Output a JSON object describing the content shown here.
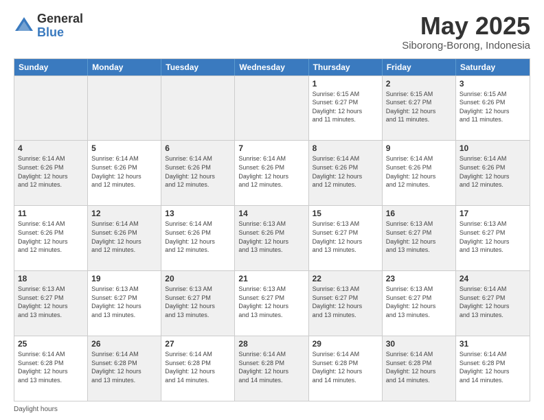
{
  "logo": {
    "general": "General",
    "blue": "Blue"
  },
  "title": "May 2025",
  "location": "Siborong-Borong, Indonesia",
  "header_days": [
    "Sunday",
    "Monday",
    "Tuesday",
    "Wednesday",
    "Thursday",
    "Friday",
    "Saturday"
  ],
  "footer": "Daylight hours",
  "weeks": [
    [
      {
        "day": "",
        "info": "",
        "shaded": true
      },
      {
        "day": "",
        "info": "",
        "shaded": true
      },
      {
        "day": "",
        "info": "",
        "shaded": true
      },
      {
        "day": "",
        "info": "",
        "shaded": true
      },
      {
        "day": "1",
        "info": "Sunrise: 6:15 AM\nSunset: 6:27 PM\nDaylight: 12 hours\nand 11 minutes.",
        "shaded": false
      },
      {
        "day": "2",
        "info": "Sunrise: 6:15 AM\nSunset: 6:27 PM\nDaylight: 12 hours\nand 11 minutes.",
        "shaded": true
      },
      {
        "day": "3",
        "info": "Sunrise: 6:15 AM\nSunset: 6:26 PM\nDaylight: 12 hours\nand 11 minutes.",
        "shaded": false
      }
    ],
    [
      {
        "day": "4",
        "info": "Sunrise: 6:14 AM\nSunset: 6:26 PM\nDaylight: 12 hours\nand 12 minutes.",
        "shaded": true
      },
      {
        "day": "5",
        "info": "Sunrise: 6:14 AM\nSunset: 6:26 PM\nDaylight: 12 hours\nand 12 minutes.",
        "shaded": false
      },
      {
        "day": "6",
        "info": "Sunrise: 6:14 AM\nSunset: 6:26 PM\nDaylight: 12 hours\nand 12 minutes.",
        "shaded": true
      },
      {
        "day": "7",
        "info": "Sunrise: 6:14 AM\nSunset: 6:26 PM\nDaylight: 12 hours\nand 12 minutes.",
        "shaded": false
      },
      {
        "day": "8",
        "info": "Sunrise: 6:14 AM\nSunset: 6:26 PM\nDaylight: 12 hours\nand 12 minutes.",
        "shaded": true
      },
      {
        "day": "9",
        "info": "Sunrise: 6:14 AM\nSunset: 6:26 PM\nDaylight: 12 hours\nand 12 minutes.",
        "shaded": false
      },
      {
        "day": "10",
        "info": "Sunrise: 6:14 AM\nSunset: 6:26 PM\nDaylight: 12 hours\nand 12 minutes.",
        "shaded": true
      }
    ],
    [
      {
        "day": "11",
        "info": "Sunrise: 6:14 AM\nSunset: 6:26 PM\nDaylight: 12 hours\nand 12 minutes.",
        "shaded": false
      },
      {
        "day": "12",
        "info": "Sunrise: 6:14 AM\nSunset: 6:26 PM\nDaylight: 12 hours\nand 12 minutes.",
        "shaded": true
      },
      {
        "day": "13",
        "info": "Sunrise: 6:14 AM\nSunset: 6:26 PM\nDaylight: 12 hours\nand 12 minutes.",
        "shaded": false
      },
      {
        "day": "14",
        "info": "Sunrise: 6:13 AM\nSunset: 6:26 PM\nDaylight: 12 hours\nand 13 minutes.",
        "shaded": true
      },
      {
        "day": "15",
        "info": "Sunrise: 6:13 AM\nSunset: 6:27 PM\nDaylight: 12 hours\nand 13 minutes.",
        "shaded": false
      },
      {
        "day": "16",
        "info": "Sunrise: 6:13 AM\nSunset: 6:27 PM\nDaylight: 12 hours\nand 13 minutes.",
        "shaded": true
      },
      {
        "day": "17",
        "info": "Sunrise: 6:13 AM\nSunset: 6:27 PM\nDaylight: 12 hours\nand 13 minutes.",
        "shaded": false
      }
    ],
    [
      {
        "day": "18",
        "info": "Sunrise: 6:13 AM\nSunset: 6:27 PM\nDaylight: 12 hours\nand 13 minutes.",
        "shaded": true
      },
      {
        "day": "19",
        "info": "Sunrise: 6:13 AM\nSunset: 6:27 PM\nDaylight: 12 hours\nand 13 minutes.",
        "shaded": false
      },
      {
        "day": "20",
        "info": "Sunrise: 6:13 AM\nSunset: 6:27 PM\nDaylight: 12 hours\nand 13 minutes.",
        "shaded": true
      },
      {
        "day": "21",
        "info": "Sunrise: 6:13 AM\nSunset: 6:27 PM\nDaylight: 12 hours\nand 13 minutes.",
        "shaded": false
      },
      {
        "day": "22",
        "info": "Sunrise: 6:13 AM\nSunset: 6:27 PM\nDaylight: 12 hours\nand 13 minutes.",
        "shaded": true
      },
      {
        "day": "23",
        "info": "Sunrise: 6:13 AM\nSunset: 6:27 PM\nDaylight: 12 hours\nand 13 minutes.",
        "shaded": false
      },
      {
        "day": "24",
        "info": "Sunrise: 6:14 AM\nSunset: 6:27 PM\nDaylight: 12 hours\nand 13 minutes.",
        "shaded": true
      }
    ],
    [
      {
        "day": "25",
        "info": "Sunrise: 6:14 AM\nSunset: 6:28 PM\nDaylight: 12 hours\nand 13 minutes.",
        "shaded": false
      },
      {
        "day": "26",
        "info": "Sunrise: 6:14 AM\nSunset: 6:28 PM\nDaylight: 12 hours\nand 13 minutes.",
        "shaded": true
      },
      {
        "day": "27",
        "info": "Sunrise: 6:14 AM\nSunset: 6:28 PM\nDaylight: 12 hours\nand 14 minutes.",
        "shaded": false
      },
      {
        "day": "28",
        "info": "Sunrise: 6:14 AM\nSunset: 6:28 PM\nDaylight: 12 hours\nand 14 minutes.",
        "shaded": true
      },
      {
        "day": "29",
        "info": "Sunrise: 6:14 AM\nSunset: 6:28 PM\nDaylight: 12 hours\nand 14 minutes.",
        "shaded": false
      },
      {
        "day": "30",
        "info": "Sunrise: 6:14 AM\nSunset: 6:28 PM\nDaylight: 12 hours\nand 14 minutes.",
        "shaded": true
      },
      {
        "day": "31",
        "info": "Sunrise: 6:14 AM\nSunset: 6:28 PM\nDaylight: 12 hours\nand 14 minutes.",
        "shaded": false
      }
    ]
  ]
}
